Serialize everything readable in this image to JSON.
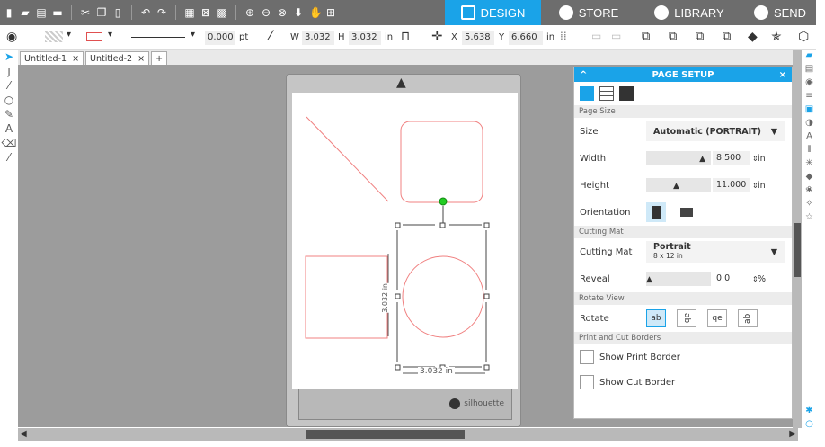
{
  "tabs": {
    "design": "DESIGN",
    "store": "STORE",
    "library": "LIBRARY",
    "send": "SEND"
  },
  "toolbar": {
    "line_width": "0.000",
    "line_unit": "pt",
    "w_label": "W",
    "w_value": "3.032",
    "h_label": "H",
    "h_value": "3.032",
    "size_unit": "in",
    "x_label": "X",
    "x_value": "5.638",
    "y_label": "Y",
    "y_value": "6.660",
    "pos_unit": "in"
  },
  "doc_tabs": [
    {
      "label": "Untitled-1",
      "close": "×"
    },
    {
      "label": "Untitled-2",
      "close": "×"
    },
    {
      "label": "+"
    }
  ],
  "canvas": {
    "dim_vertical": "3.032 in",
    "dim_horizontal": "3.032 in",
    "brand": "silhouette"
  },
  "panel": {
    "title": "PAGE SETUP",
    "collapse": "^",
    "close": "×",
    "page_size_header": "Page Size",
    "size_label": "Size",
    "size_value": "Automatic (PORTRAIT)",
    "width_label": "Width",
    "width_value": "8.500",
    "width_unit": "in",
    "height_label": "Height",
    "height_value": "11.000",
    "height_unit": "in",
    "orientation_label": "Orientation",
    "cutting_mat_header": "Cutting Mat",
    "cutting_mat_label": "Cutting Mat",
    "cutting_mat_value": "Portrait",
    "cutting_mat_sub": "8 x 12 in",
    "reveal_label": "Reveal",
    "reveal_value": "0.0",
    "reveal_unit": "%",
    "rotate_view_header": "Rotate View",
    "rotate_label": "Rotate",
    "rotate_options": [
      "ab",
      "ab",
      "qe",
      "ab"
    ],
    "print_cut_header": "Print and Cut Borders",
    "show_print_border": "Show Print Border",
    "show_cut_border": "Show Cut Border"
  },
  "colors": {
    "accent": "#1aa3e8",
    "titlebar": "#6d6d6d",
    "canvas": "#9c9c9c",
    "shape_stroke": "#f08080",
    "handle_green": "#22cc22"
  }
}
